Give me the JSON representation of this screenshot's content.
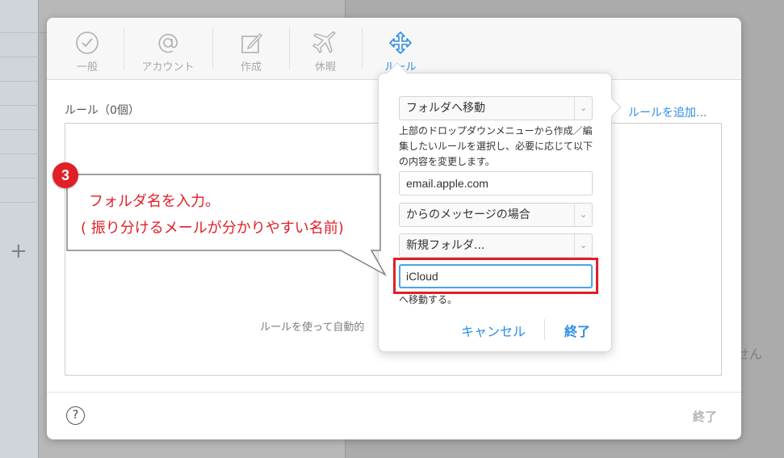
{
  "background": {
    "right_partial_text": "せん"
  },
  "toolbar": {
    "items": [
      {
        "label": "一般",
        "icon": "check-circle-icon"
      },
      {
        "label": "アカウント",
        "icon": "at-sign-icon"
      },
      {
        "label": "作成",
        "icon": "compose-icon"
      },
      {
        "label": "休暇",
        "icon": "airplane-icon"
      },
      {
        "label": "ルール",
        "icon": "arrows-icon",
        "active": true
      }
    ]
  },
  "rules": {
    "title": "ルール（0個）",
    "add_link": "ルールを追加...",
    "empty_text": "ルールを使って自動的"
  },
  "footer": {
    "help_label": "?",
    "done_label": "終了"
  },
  "popover": {
    "action_select": "フォルダへ移動",
    "description": "上部のドロップダウンメニューから作成／編集したいルールを選択し、必要に応じて以下の内容を変更します。",
    "email_value": "email.apple.com",
    "condition_select": "からのメッセージの場合",
    "folder_select": "新規フォルダ...",
    "folder_name_value": "iCloud",
    "move_suffix": "へ移動する。",
    "cancel_label": "キャンセル",
    "finish_label": "終了"
  },
  "annotation": {
    "step_number": "3",
    "line1": "フォルダ名を入力。",
    "line2": "( 振り分けるメールが分かりやすい名前)",
    "color": "#e01f26"
  },
  "colors": {
    "accent": "#2b8ee6",
    "highlight_red": "#e01f26"
  }
}
